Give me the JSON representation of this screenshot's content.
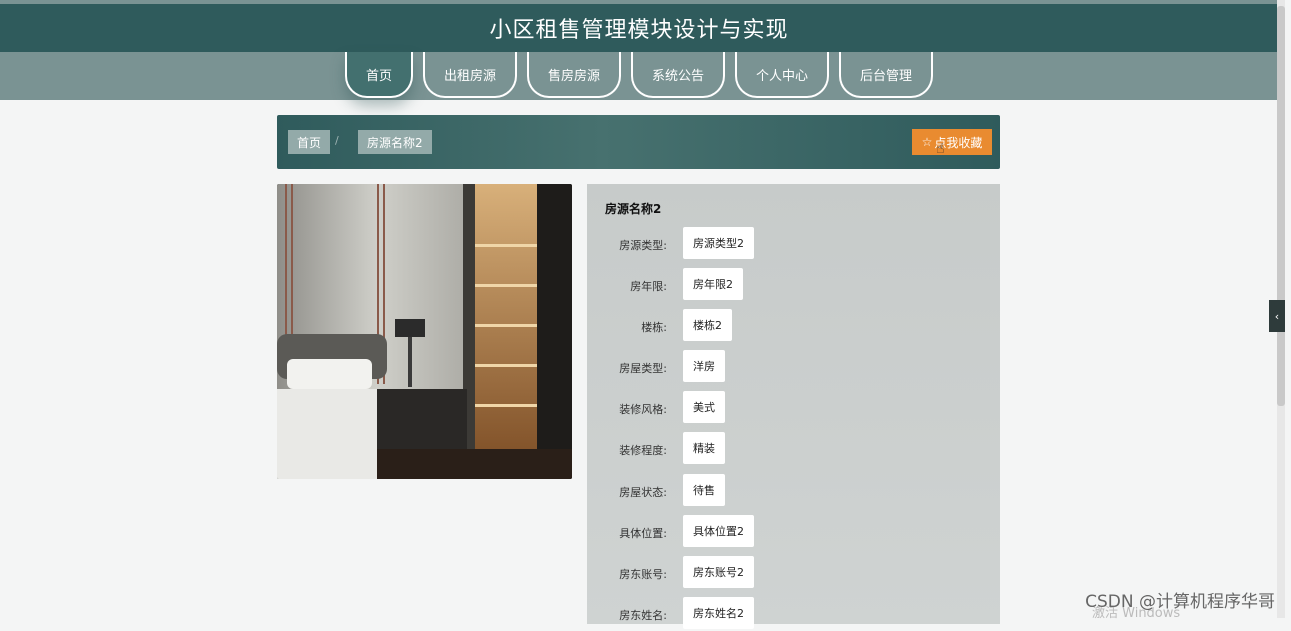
{
  "site": {
    "title": "小区租售管理模块设计与实现"
  },
  "nav": {
    "items": [
      {
        "label": "首页",
        "active": true
      },
      {
        "label": "出租房源",
        "active": false
      },
      {
        "label": "售房房源",
        "active": false
      },
      {
        "label": "系统公告",
        "active": false
      },
      {
        "label": "个人中心",
        "active": false
      },
      {
        "label": "后台管理",
        "active": false
      }
    ]
  },
  "breadcrumb": {
    "home": "首页",
    "separator": "/",
    "current": "房源名称2"
  },
  "favorite_button": {
    "icon": "star-outline-icon",
    "label": "点我收藏"
  },
  "detail": {
    "title": "房源名称2",
    "fields": [
      {
        "label": "房源类型:",
        "value": "房源类型2"
      },
      {
        "label": "房年限:",
        "value": "房年限2"
      },
      {
        "label": "楼栋:",
        "value": "楼栋2"
      },
      {
        "label": "房屋类型:",
        "value": "洋房"
      },
      {
        "label": "装修风格:",
        "value": "美式"
      },
      {
        "label": "装修程度:",
        "value": "精装"
      },
      {
        "label": "房屋状态:",
        "value": "待售"
      },
      {
        "label": "具体位置:",
        "value": "具体位置2"
      },
      {
        "label": "房东账号:",
        "value": "房东账号2"
      },
      {
        "label": "房东姓名:",
        "value": "房东姓名2"
      }
    ]
  },
  "side_tab": {
    "icon": "chevron-left-icon",
    "glyph": "‹"
  },
  "watermark": {
    "text": "CSDN @计算机程序华哥",
    "os_text": "激活 Windows"
  },
  "colors": {
    "header": "#2f5b5c",
    "accent": "#e98b30",
    "nav_band": "#7a9393"
  }
}
